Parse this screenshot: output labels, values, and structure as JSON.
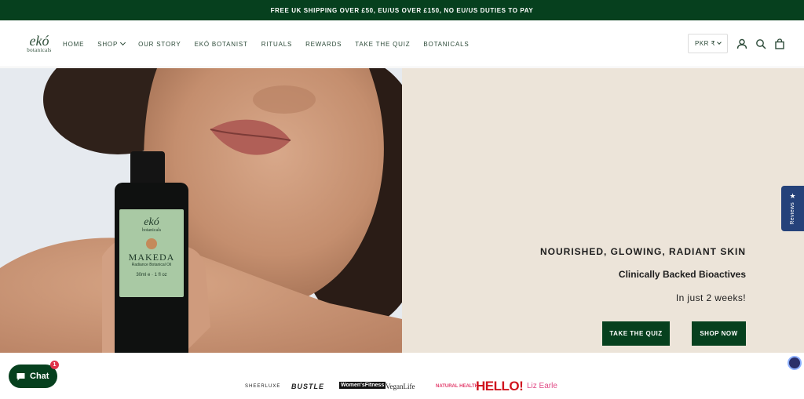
{
  "announcement": "FREE UK SHIPPING OVER £50, EU/US OVER £150, NO EU/US DUTIES TO PAY",
  "logo": {
    "main": "ekó",
    "sub": "botanicals"
  },
  "nav": [
    "HOME",
    "SHOP",
    "OUR STORY",
    "EKÓ BOTANIST",
    "RITUALS",
    "REWARDS",
    "TAKE THE QUIZ",
    "BOTANICALS"
  ],
  "currency": "PKR ₹",
  "hero": {
    "headline": "NOURISHED, GLOWING, RADIANT SKIN",
    "subheadline": "Clinically Backed Bioactives",
    "note": "In just 2 weeks!",
    "btn_quiz": "TAKE THE QUIZ",
    "btn_shop": "SHOP NOW",
    "bottle": {
      "brand": "ekó",
      "brand_sub": "botanicals",
      "product": "MAKEDA",
      "desc": "Radiance Botanical Oil",
      "size": "30ml e · 1 fl oz"
    }
  },
  "reviews_tab": "Reviews",
  "chat": {
    "label": "Chat",
    "badge": "1"
  },
  "press": [
    "SHEERLUXE",
    "BUSTLE",
    "Women'sFitness",
    "VeganLife",
    "NATURAL HEALTH",
    "HELLO!",
    "Liz Earle"
  ],
  "colors": {
    "brand_green": "#06401e",
    "panel_beige": "#ece4d9",
    "reviews_blue": "#25427a",
    "hello_red": "#d0151f",
    "liz_pink": "#e14b86",
    "nh_pink": "#e23c6b"
  }
}
